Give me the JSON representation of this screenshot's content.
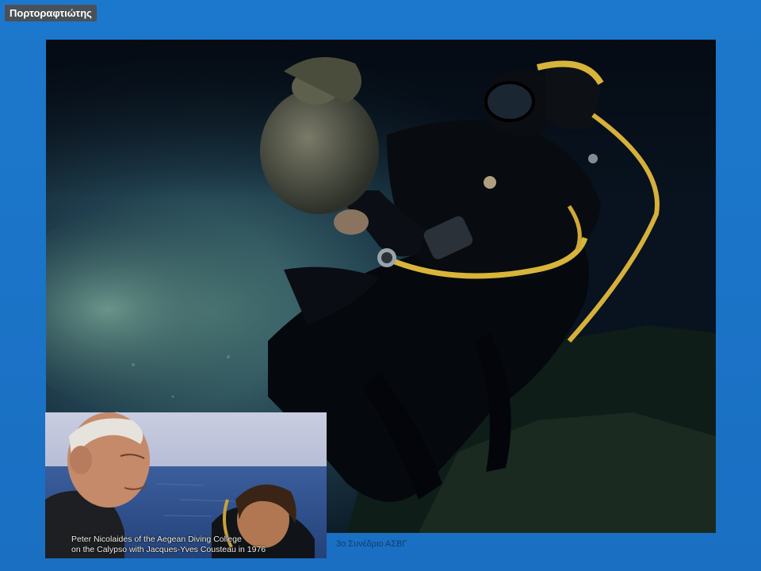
{
  "slide": {
    "title": "Πορτοραφτιώτης",
    "footer": "3ο Συνέδριο ΑΣΒΓ",
    "background_color": "#1a73c6"
  },
  "main_image": {
    "subject": "underwater diver in black wetsuit with yellow hose holding an amphora-like object"
  },
  "inset_image": {
    "subject": "two men on a boat deck with sea in background",
    "caption_line_1": "Peter Nicolaides of the Aegean Diving College",
    "caption_line_2": "on the Calypso with Jacques-Yves  Cousteau in 1976"
  }
}
